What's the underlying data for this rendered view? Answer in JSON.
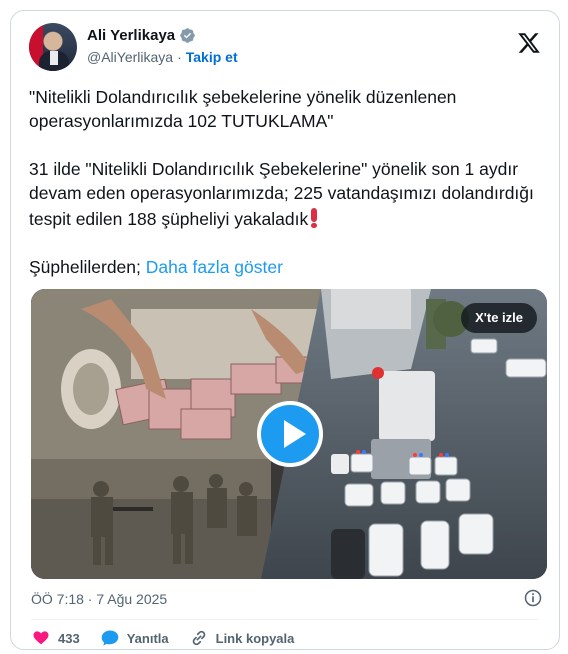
{
  "author": {
    "name": "Ali Yerlikaya",
    "handle": "@AliYerlikaya",
    "separator": "·",
    "follow_label": "Takip et"
  },
  "tweet": {
    "paragraph1": "\"Nitelikli Dolandırıcılık şebekelerine yönelik düzenlenen operasyonlarımızda 102 TUTUKLAMA\"",
    "paragraph2": "31 ilde \"Nitelikli Dolandırıcılık Şebekelerine\" yönelik son 1 aydır devam eden operasyonlarımızda; 225 vatandaşımızı dolandırdığı tespit edilen 188 şüpheliyi yakaladık",
    "paragraph3": "Şüphelilerden;",
    "show_more": "Daha fazla göster"
  },
  "media": {
    "watch_label": "X'te izle"
  },
  "timestamp": "ÖÖ 7:18 · 7 Ağu 2025",
  "actions": {
    "likes": "433",
    "reply_label": "Yanıtla",
    "copy_link_label": "Link kopyala"
  },
  "colors": {
    "accent": "#1d9bf0",
    "like": "#f91880",
    "text_secondary": "#536471"
  },
  "icons": [
    "verified-badge-icon",
    "x-logo-icon",
    "play-icon",
    "info-icon",
    "heart-icon",
    "reply-icon",
    "link-icon"
  ]
}
